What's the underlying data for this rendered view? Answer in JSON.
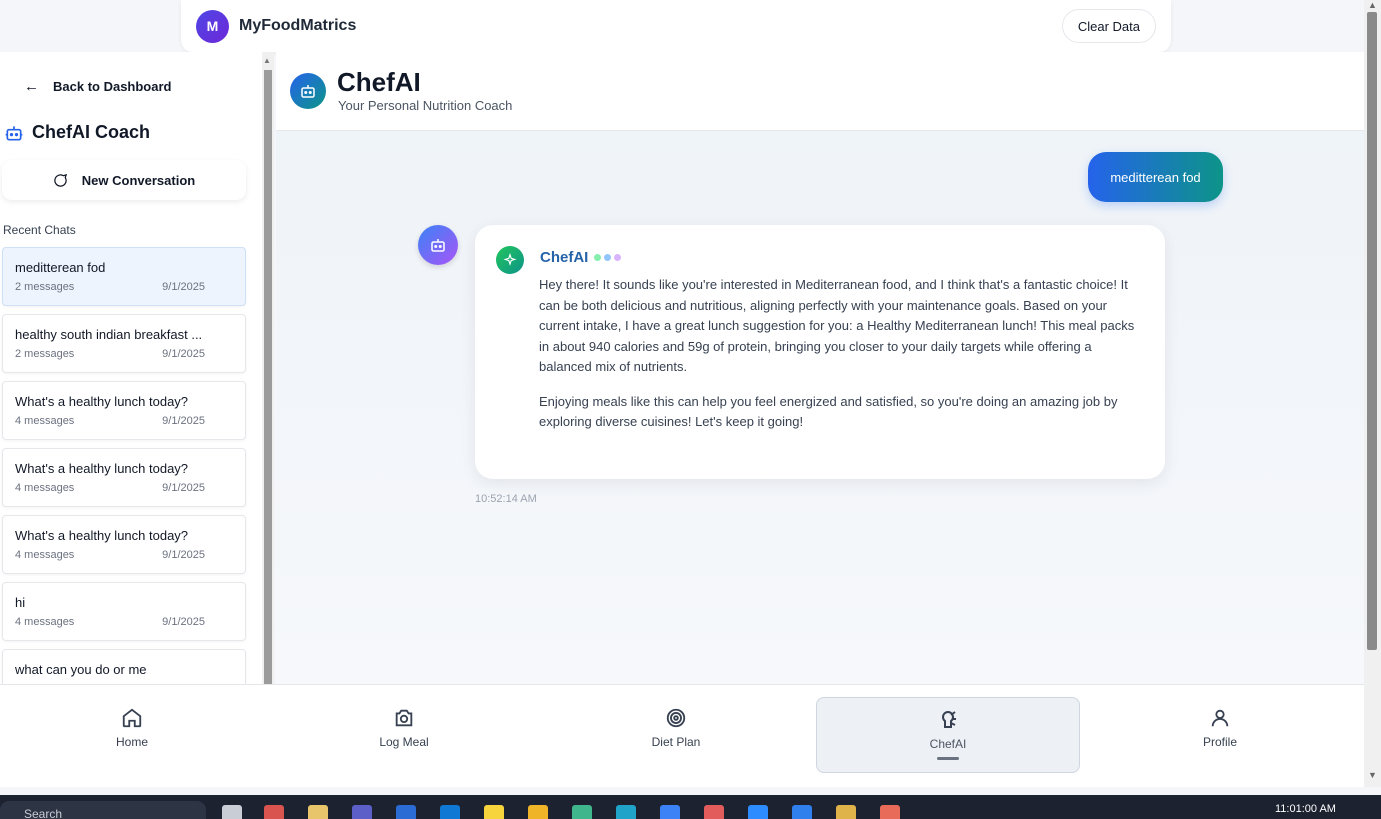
{
  "header": {
    "logo_letter": "M",
    "app_name": "MyFoodMatrics",
    "clear_label": "Clear Data"
  },
  "sidebar": {
    "back_label": "Back to Dashboard",
    "title": "ChefAI Coach",
    "new_conversation_label": "New Conversation",
    "recent_label": "Recent Chats",
    "chats": [
      {
        "title": "meditterean fod",
        "meta": "2 messages",
        "date": "9/1/2025"
      },
      {
        "title": "healthy south indian breakfast ...",
        "meta": "2 messages",
        "date": "9/1/2025"
      },
      {
        "title": "What's a healthy lunch today?",
        "meta": "4 messages",
        "date": "9/1/2025"
      },
      {
        "title": "What's a healthy lunch today?",
        "meta": "4 messages",
        "date": "9/1/2025"
      },
      {
        "title": "What's a healthy lunch today?",
        "meta": "4 messages",
        "date": "9/1/2025"
      },
      {
        "title": "hi",
        "meta": "4 messages",
        "date": "9/1/2025"
      },
      {
        "title": "what can you do or me",
        "meta": "",
        "date": ""
      }
    ]
  },
  "main": {
    "title": "ChefAI",
    "subtitle": "Your Personal Nutrition Coach",
    "user_message": "meditterean fod",
    "ai_name": "ChefAI",
    "ai_paragraph_1": "Hey there! It sounds like you're interested in Mediterranean food, and I think that's a fantastic choice! It can be both delicious and nutritious, aligning perfectly with your maintenance goals. Based on your current intake, I have a great lunch suggestion for you: a Healthy Mediterranean lunch! This meal packs in about 940 calories and 59g of protein, bringing you closer to your daily targets while offering a balanced mix of nutrients.",
    "ai_paragraph_2": "Enjoying meals like this can help you feel energized and satisfied, so you're doing an amazing job by exploring diverse cuisines! Let's keep it going!",
    "timestamp": "10:52:14 AM"
  },
  "nav": {
    "items": [
      {
        "label": "Home",
        "icon": "home-icon"
      },
      {
        "label": "Log Meal",
        "icon": "camera-icon"
      },
      {
        "label": "Diet Plan",
        "icon": "target-icon"
      },
      {
        "label": "ChefAI",
        "icon": "chef-icon",
        "active": true
      },
      {
        "label": "Profile",
        "icon": "user-icon"
      }
    ]
  },
  "taskbar": {
    "search_placeholder": "Search",
    "clock": "11:01:00 AM"
  },
  "colors": {
    "accent_blue": "#2563eb",
    "accent_teal": "#0d9488",
    "ai_name": "#2563a8",
    "logo": "#4f46e5"
  }
}
